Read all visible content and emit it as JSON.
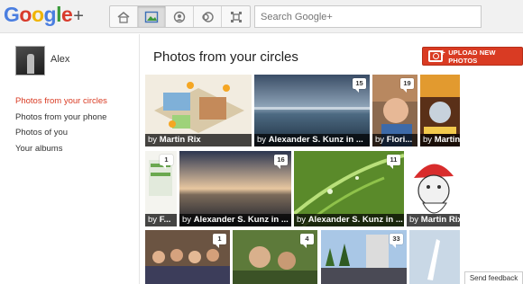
{
  "brand": {
    "logo_letters": [
      "G",
      "o",
      "o",
      "g",
      "l",
      "e"
    ],
    "logo_plus": "+"
  },
  "topnav": {
    "buttons": [
      "home-icon",
      "photos-icon",
      "profile-icon",
      "circles-icon",
      "games-icon"
    ],
    "active": "photos-icon"
  },
  "search": {
    "placeholder": "Search Google+"
  },
  "sidebar": {
    "user_name": "Alex",
    "items": [
      {
        "label": "Photos from your circles",
        "active": true
      },
      {
        "label": "Photos from your phone",
        "active": false
      },
      {
        "label": "Photos of you",
        "active": false
      },
      {
        "label": "Your albums",
        "active": false
      }
    ]
  },
  "main": {
    "title": "Photos from your circles",
    "upload_label": "UPLOAD NEW PHOTOS"
  },
  "photos": [
    {
      "by": "by ",
      "author": "Martin Rix",
      "badge": ""
    },
    {
      "by": "by ",
      "author": "Alexander S. Kunz in ...",
      "badge": "15"
    },
    {
      "by": "by ",
      "author": "Flori...",
      "badge": "19"
    },
    {
      "by": "by ",
      "author": "Martin",
      "badge": ""
    },
    {
      "by": "by ",
      "author": "F...",
      "badge": "1"
    },
    {
      "by": "by ",
      "author": "Alexander S. Kunz in ...",
      "badge": "16"
    },
    {
      "by": "by ",
      "author": "Alexander S. Kunz in ...",
      "badge": "11"
    },
    {
      "by": "by ",
      "author": "Martin Rix",
      "badge": ""
    },
    {
      "by": "",
      "author": "",
      "badge": "1"
    },
    {
      "by": "",
      "author": "",
      "badge": "4"
    },
    {
      "by": "",
      "author": "",
      "badge": "33"
    },
    {
      "by": "",
      "author": "",
      "badge": ""
    }
  ],
  "footer": {
    "feedback": "Send feedback"
  },
  "colors": {
    "accent": "#d93b23",
    "topbar": "#f1f1f1"
  }
}
